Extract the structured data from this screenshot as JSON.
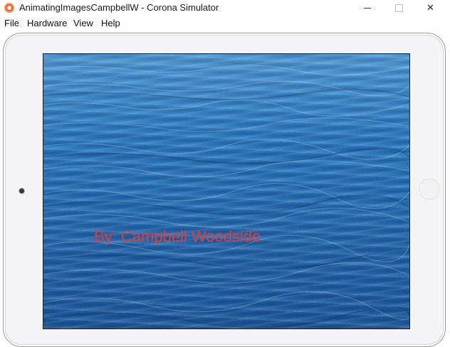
{
  "window": {
    "title": "AnimatingImagesCampbellW - Corona Simulator",
    "close_glyph": "✕"
  },
  "menu": [
    "File",
    "Hardware",
    "View",
    "Help"
  ],
  "app": {
    "credit_text": "By: Campbell Woodside",
    "credit_color": "#e23b3b",
    "background": "ocean-water-image"
  }
}
